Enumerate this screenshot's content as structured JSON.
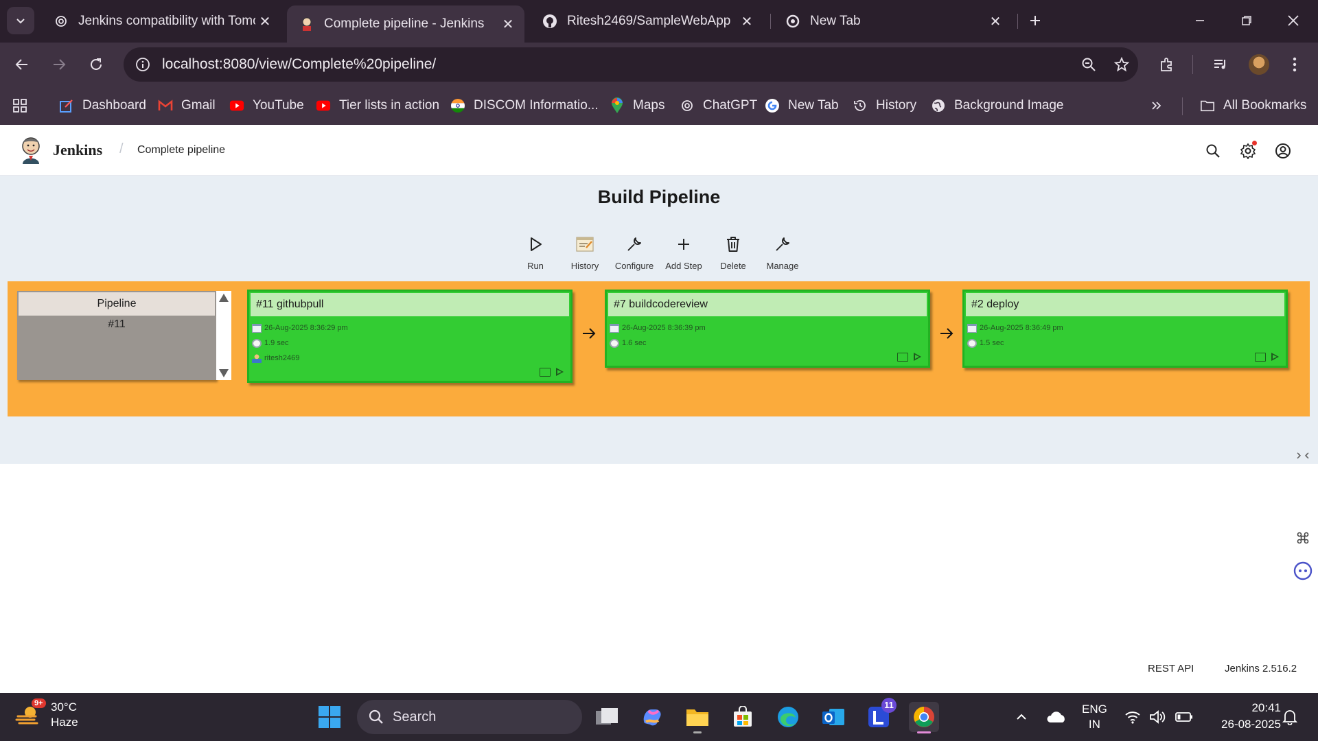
{
  "browser": {
    "tabs": [
      {
        "title": "Jenkins compatibility with Tomc",
        "icon": "openai-icon",
        "active": false
      },
      {
        "title": "Complete pipeline - Jenkins",
        "icon": "jenkins-icon",
        "active": true
      },
      {
        "title": "Ritesh2469/SampleWebApp",
        "icon": "github-icon",
        "active": false
      },
      {
        "title": "New Tab",
        "icon": "chrome-icon",
        "active": false
      }
    ],
    "url": "localhost:8080/view/Complete%20pipeline/",
    "bookmarks": [
      {
        "label": "Dashboard",
        "icon": "dashboard-icon"
      },
      {
        "label": "Gmail",
        "icon": "gmail-icon"
      },
      {
        "label": "YouTube",
        "icon": "youtube-icon"
      },
      {
        "label": "Tier lists in action",
        "icon": "youtube-icon"
      },
      {
        "label": "DISCOM Informatio...",
        "icon": "india-flag-icon"
      },
      {
        "label": "Maps",
        "icon": "maps-icon"
      },
      {
        "label": "ChatGPT",
        "icon": "openai-icon"
      },
      {
        "label": "New Tab",
        "icon": "google-icon"
      },
      {
        "label": "History",
        "icon": "history-icon"
      },
      {
        "label": "Background Image",
        "icon": "globe-icon"
      }
    ],
    "all_bookmarks_label": "All Bookmarks"
  },
  "jenkins": {
    "brand": "Jenkins",
    "breadcrumb": "Complete pipeline",
    "page_title": "Build Pipeline",
    "toolbar": [
      {
        "label": "Run",
        "icon": "play-icon"
      },
      {
        "label": "History",
        "icon": "notepad-icon"
      },
      {
        "label": "Configure",
        "icon": "wrench-icon"
      },
      {
        "label": "Add Step",
        "icon": "plus-icon"
      },
      {
        "label": "Delete",
        "icon": "trash-icon"
      },
      {
        "label": "Manage",
        "icon": "wrench-icon"
      }
    ],
    "pipeline_card": {
      "title": "Pipeline",
      "number": "#11"
    },
    "stages": [
      {
        "title": "#11 githubpull",
        "date": "26-Aug-2025 8:36:29 pm",
        "duration": "1.9 sec",
        "user": "ritesh2469",
        "status_color": "#33cc33"
      },
      {
        "title": "#7 buildcodereview",
        "date": "26-Aug-2025 8:36:39 pm",
        "duration": "1.6 sec",
        "status_color": "#33cc33"
      },
      {
        "title": "#2 deploy",
        "date": "26-Aug-2025 8:36:49 pm",
        "duration": "1.5 sec",
        "status_color": "#33cc33"
      }
    ],
    "band_color": "#fbab3c",
    "footer": {
      "rest_api": "REST API",
      "version": "Jenkins 2.516.2"
    }
  },
  "taskbar": {
    "weather": {
      "temp": "30°C",
      "condition": "Haze",
      "badge": "9+"
    },
    "search_placeholder": "Search",
    "outlook_badge": "11",
    "language": {
      "line1": "ENG",
      "line2": "IN"
    },
    "time": "20:41",
    "date": "26-08-2025"
  }
}
